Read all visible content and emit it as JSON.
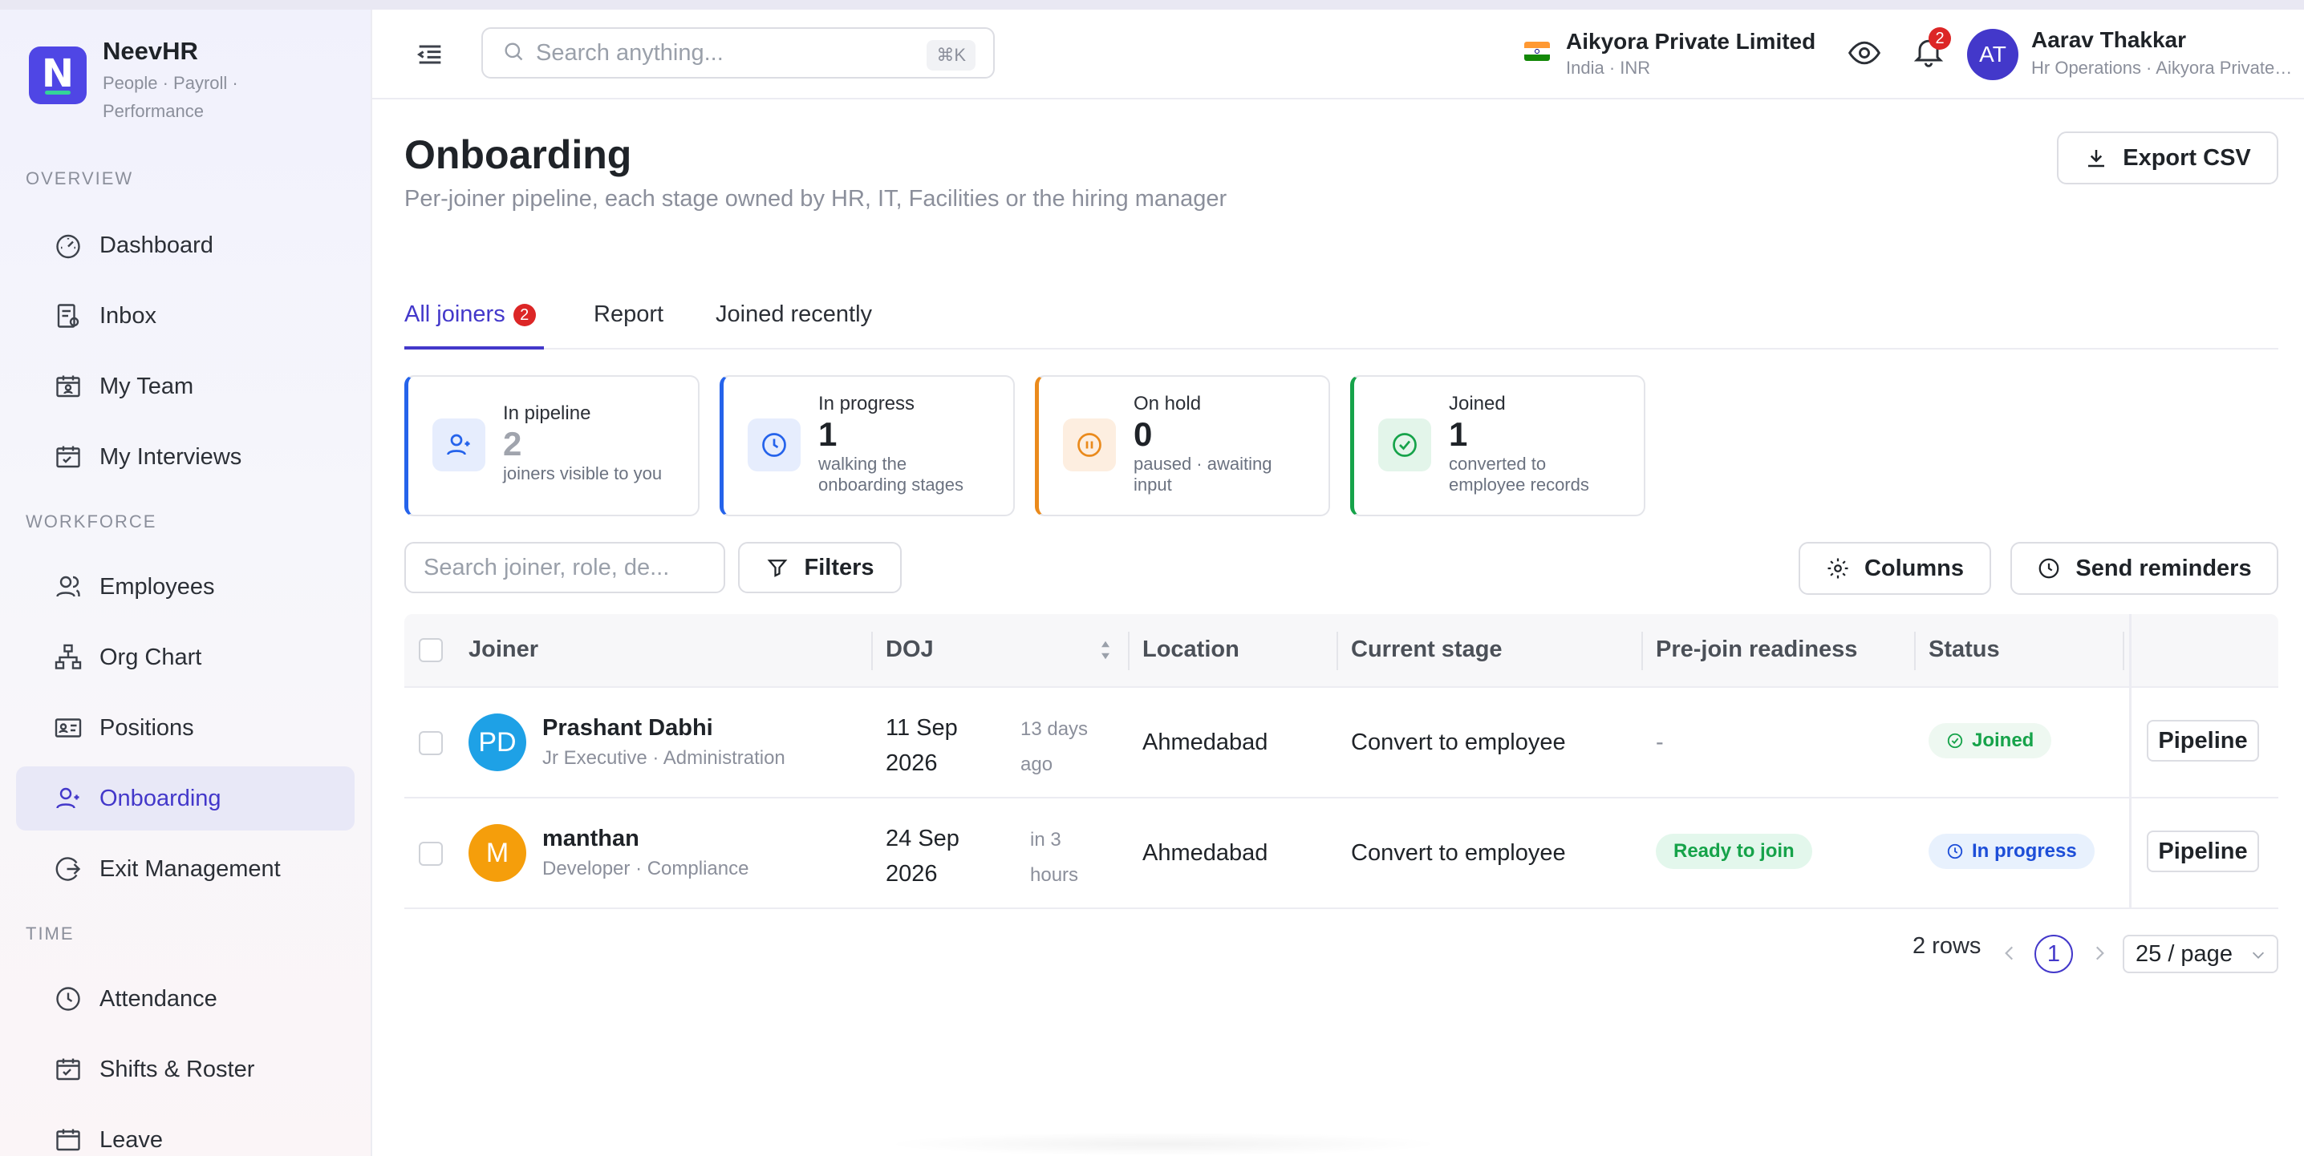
{
  "brand": {
    "name": "NeevHR",
    "tagline": "People · Payroll · Performance",
    "logo_letter": "N",
    "color": "#4f46e5"
  },
  "sidebar": {
    "sections": {
      "overview": "OVERVIEW",
      "workforce": "WORKFORCE",
      "time": "TIME"
    },
    "items": [
      {
        "label": "Dashboard",
        "icon": "dashboard-icon"
      },
      {
        "label": "Inbox",
        "icon": "inbox-icon"
      },
      {
        "label": "My Team",
        "icon": "team-icon"
      },
      {
        "label": "My Interviews",
        "icon": "calendar-check-icon"
      },
      {
        "label": "Employees",
        "icon": "users-icon"
      },
      {
        "label": "Org Chart",
        "icon": "org-chart-icon"
      },
      {
        "label": "Positions",
        "icon": "id-card-icon"
      },
      {
        "label": "Onboarding",
        "icon": "user-icon",
        "active": true
      },
      {
        "label": "Exit Management",
        "icon": "exit-icon"
      },
      {
        "label": "Attendance",
        "icon": "clock-icon"
      },
      {
        "label": "Shifts & Roster",
        "icon": "calendar-check-icon"
      },
      {
        "label": "Leave",
        "icon": "calendar-icon"
      }
    ]
  },
  "header": {
    "search_placeholder": "Search anything...",
    "search_shortcut": "⌘K",
    "company_name": "Aikyora Private Limited",
    "company_sub": "India · INR",
    "notifications_count": "2",
    "user_initials": "AT",
    "user_name": "Aarav Thakkar",
    "user_role": "Hr Operations · Aikyora Private Limited"
  },
  "page": {
    "title": "Onboarding",
    "subtitle": "Per-joiner pipeline, each stage owned by HR, IT, Facilities or the hiring manager",
    "export_label": "Export CSV"
  },
  "tabs": [
    {
      "label": "All joiners",
      "badge": "2",
      "active": true
    },
    {
      "label": "Report"
    },
    {
      "label": "Joined recently"
    }
  ],
  "stats": [
    {
      "label": "In pipeline",
      "value": "2",
      "note": "joiners visible to you",
      "color": "#2563eb"
    },
    {
      "label": "In progress",
      "value": "1",
      "note": "walking the onboarding stages",
      "color": "#2563eb"
    },
    {
      "label": "On hold",
      "value": "0",
      "note": "paused · awaiting input",
      "color": "#ea8a1c"
    },
    {
      "label": "Joined",
      "value": "1",
      "note": "converted to employee records",
      "color": "#16a34a"
    }
  ],
  "toolbar": {
    "search_placeholder": "Search joiner, role, de...",
    "filters_label": "Filters",
    "columns_label": "Columns",
    "reminders_label": "Send reminders"
  },
  "table": {
    "columns": [
      "Joiner",
      "DOJ",
      "Location",
      "Current stage",
      "Pre-join readiness",
      "Status"
    ],
    "rows": [
      {
        "initials": "PD",
        "avatar_color": "#1ea1e6",
        "name": "Prashant Dabhi",
        "role": "Jr Executive · Administration",
        "doj": "11 Sep 2026",
        "doj_relative": "13 days ago",
        "location": "Ahmedabad",
        "stage": "Convert to employee",
        "readiness": "-",
        "status": "Joined",
        "action": "Pipeline"
      },
      {
        "initials": "M",
        "avatar_color": "#f59e0b",
        "name": "manthan",
        "role": "Developer · Compliance",
        "doj": "24 Sep 2026",
        "doj_relative": "in 3 hours",
        "location": "Ahmedabad",
        "stage": "Convert to employee",
        "readiness": "Ready to join",
        "status": "In progress",
        "action": "Pipeline"
      }
    ]
  },
  "pagination": {
    "rows_label": "2 rows",
    "current_page": "1",
    "page_size": "25 / page"
  }
}
